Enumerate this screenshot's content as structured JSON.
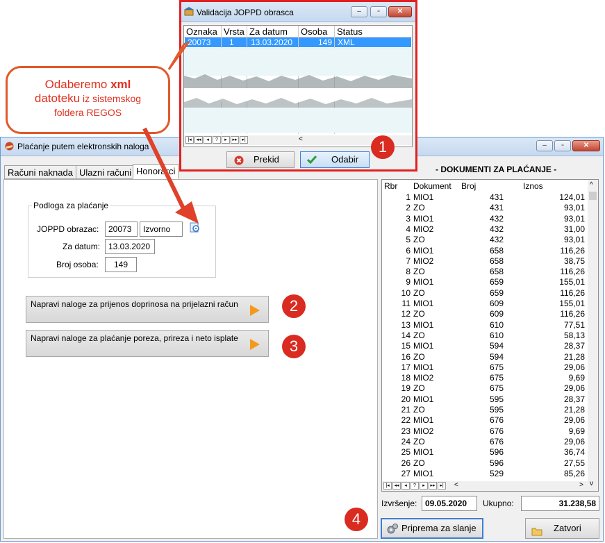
{
  "main_window": {
    "title": "Plaćanje putem elektronskih naloga",
    "tabs": [
      "Računi naknada",
      "Ulazni računi",
      "Honorarci"
    ],
    "group_title": "Podloga za plaćanje",
    "joppd_label": "JOPPD obrazac:",
    "joppd_value": "20073",
    "joppd_type": "Izvorno",
    "date_label": "Za datum:",
    "date_value": "13.03.2020",
    "persons_label": "Broj osoba:",
    "persons_value": "149",
    "btn_doprinosi": "Napravi naloge za prijenos doprinosa na prijelazni račun",
    "btn_porezi": "Napravi naloge za plaćanje poreza, prireza i neto isplate",
    "docs_title": "- DOKUMENTI ZA PLAĆANJE -",
    "columns": [
      "Rbr",
      "Dokument",
      "Broj",
      "Iznos"
    ],
    "rows": [
      [
        "1",
        "MIO1",
        "431",
        "124,01"
      ],
      [
        "2",
        "ZO",
        "431",
        "93,01"
      ],
      [
        "3",
        "MIO1",
        "432",
        "93,01"
      ],
      [
        "4",
        "MIO2",
        "432",
        "31,00"
      ],
      [
        "5",
        "ZO",
        "432",
        "93,01"
      ],
      [
        "6",
        "MIO1",
        "658",
        "116,26"
      ],
      [
        "7",
        "MIO2",
        "658",
        "38,75"
      ],
      [
        "8",
        "ZO",
        "658",
        "116,26"
      ],
      [
        "9",
        "MIO1",
        "659",
        "155,01"
      ],
      [
        "10",
        "ZO",
        "659",
        "116,26"
      ],
      [
        "11",
        "MIO1",
        "609",
        "155,01"
      ],
      [
        "12",
        "ZO",
        "609",
        "116,26"
      ],
      [
        "13",
        "MIO1",
        "610",
        "77,51"
      ],
      [
        "14",
        "ZO",
        "610",
        "58,13"
      ],
      [
        "15",
        "MIO1",
        "594",
        "28,37"
      ],
      [
        "16",
        "ZO",
        "594",
        "21,28"
      ],
      [
        "17",
        "MIO1",
        "675",
        "29,06"
      ],
      [
        "18",
        "MIO2",
        "675",
        "9,69"
      ],
      [
        "19",
        "ZO",
        "675",
        "29,06"
      ],
      [
        "20",
        "MIO1",
        "595",
        "28,37"
      ],
      [
        "21",
        "ZO",
        "595",
        "21,28"
      ],
      [
        "22",
        "MIO1",
        "676",
        "29,06"
      ],
      [
        "23",
        "MIO2",
        "676",
        "9,69"
      ],
      [
        "24",
        "ZO",
        "676",
        "29,06"
      ],
      [
        "25",
        "MIO1",
        "596",
        "36,74"
      ],
      [
        "26",
        "ZO",
        "596",
        "27,55"
      ],
      [
        "27",
        "MIO1",
        "529",
        "85,26"
      ]
    ],
    "exec_label": "Izvršenje:",
    "exec_date": "09.05.2020",
    "total_label": "Ukupno:",
    "total_value": "31.238,58",
    "btn_priprema": "Priprema za slanje",
    "btn_zatvori": "Zatvori"
  },
  "popup": {
    "title": "Validacija JOPPD obrasca",
    "columns": [
      "Oznaka",
      "Vrsta",
      "Za datum",
      "Osoba",
      "Status"
    ],
    "row": [
      "20073",
      "1",
      "13.03.2020",
      "149",
      "XML"
    ],
    "btn_prekid": "Prekid",
    "btn_odabir": "Odabir"
  },
  "callout": {
    "line1_a": "Odaberemo ",
    "line1_b": "xml",
    "line2_a": "datoteku",
    "line2_b": " iz sistemskog",
    "line3": "foldera REGOS"
  },
  "steps": [
    "1",
    "2",
    "3",
    "4"
  ],
  "colors": {
    "accent_red": "#d92b20",
    "selection_blue": "#3399ff",
    "arrow": "#e0412a"
  }
}
